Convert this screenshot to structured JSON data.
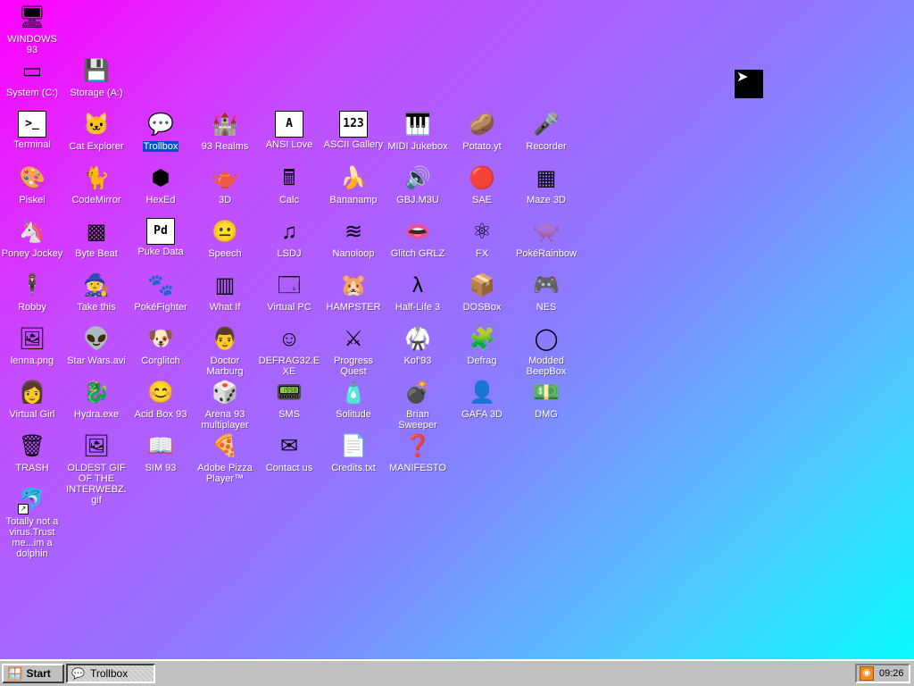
{
  "desktop": {
    "icons": [
      {
        "label": "WINDOWS 93",
        "glyph": "🖥"
      },
      {
        "label": "System (C:)",
        "glyph": "▭"
      },
      {
        "label": "Storage (A:)",
        "glyph": "💾"
      },
      {
        "label": "Terminal",
        "glyph": ">_"
      },
      {
        "label": "Cat Explorer",
        "glyph": "🐱"
      },
      {
        "label": "Trollbox",
        "glyph": "💬"
      },
      {
        "label": "93 Realms",
        "glyph": "🏰"
      },
      {
        "label": "ANSI Love",
        "glyph": "A"
      },
      {
        "label": "ASCII Gallery",
        "glyph": "123"
      },
      {
        "label": "MIDI Jukebox",
        "glyph": "🎹"
      },
      {
        "label": "Potato.yt",
        "glyph": "🥔"
      },
      {
        "label": "Recorder",
        "glyph": "🎤"
      },
      {
        "label": "Piskel",
        "glyph": "🎨"
      },
      {
        "label": "CodeMirror",
        "glyph": "🐈"
      },
      {
        "label": "HexEd",
        "glyph": "⬢"
      },
      {
        "label": "3D",
        "glyph": "🫖"
      },
      {
        "label": "Calc",
        "glyph": "🖩"
      },
      {
        "label": "Bananamp",
        "glyph": "🍌"
      },
      {
        "label": "GBJ.M3U",
        "glyph": "🔊"
      },
      {
        "label": "SAE",
        "glyph": "🔴"
      },
      {
        "label": "Maze 3D",
        "glyph": "▦"
      },
      {
        "label": "Poney Jockey",
        "glyph": "🦄"
      },
      {
        "label": "Byte Beat",
        "glyph": "▩"
      },
      {
        "label": "Puke Data",
        "glyph": "Pd"
      },
      {
        "label": "Speech",
        "glyph": "😐"
      },
      {
        "label": "LSDJ",
        "glyph": "♫"
      },
      {
        "label": "Nanoloop",
        "glyph": "≋"
      },
      {
        "label": "Glitch GRLZ",
        "glyph": "👄"
      },
      {
        "label": "FX",
        "glyph": "⚛"
      },
      {
        "label": "PokéRainbow",
        "glyph": "👾"
      },
      {
        "label": "Robby",
        "glyph": "🕴"
      },
      {
        "label": "Take this",
        "glyph": "🧙"
      },
      {
        "label": "PokéFighter",
        "glyph": "🐾"
      },
      {
        "label": "What If",
        "glyph": "▥"
      },
      {
        "label": "Virtual PC",
        "glyph": "🗔"
      },
      {
        "label": "HAMPSTER",
        "glyph": "🐹"
      },
      {
        "label": "Half-Life 3",
        "glyph": "λ"
      },
      {
        "label": "DOSBox",
        "glyph": "📦"
      },
      {
        "label": "NES",
        "glyph": "🎮"
      },
      {
        "label": "lenna.png",
        "glyph": "🖼"
      },
      {
        "label": "Star Wars.avi",
        "glyph": "👽"
      },
      {
        "label": "Corglitch",
        "glyph": "🐶"
      },
      {
        "label": "Doctor Marburg",
        "glyph": "👨"
      },
      {
        "label": "DEFRAG32.EXE",
        "glyph": "☺"
      },
      {
        "label": "Progress Quest",
        "glyph": "⚔"
      },
      {
        "label": "Kof'93",
        "glyph": "🥋"
      },
      {
        "label": "Defrag",
        "glyph": "🧩"
      },
      {
        "label": "Modded BeepBox",
        "glyph": "◯"
      },
      {
        "label": "Virtual Girl",
        "glyph": "👩"
      },
      {
        "label": "Hydra.exe",
        "glyph": "🐉"
      },
      {
        "label": "Acid Box 93",
        "glyph": "😊"
      },
      {
        "label": "Arena 93 multiplayer",
        "glyph": "🎲"
      },
      {
        "label": "SMS",
        "glyph": "📟"
      },
      {
        "label": "Solitude",
        "glyph": "🧴"
      },
      {
        "label": "Brian Sweeper",
        "glyph": "💣"
      },
      {
        "label": "GAFA 3D",
        "glyph": "👤"
      },
      {
        "label": "DMG",
        "glyph": "💵"
      },
      {
        "label": "TRASH",
        "glyph": "🗑"
      },
      {
        "label": "OLDEST GIF OF THE INTERWEBZ.gif",
        "glyph": "🖼"
      },
      {
        "label": "SIM 93",
        "glyph": "📖"
      },
      {
        "label": "Adobe Pizza Player™",
        "glyph": "🍕"
      },
      {
        "label": "Contact us",
        "glyph": "✉"
      },
      {
        "label": "Credits.txt",
        "glyph": "📄"
      },
      {
        "label": "MANIFESTO",
        "glyph": "❓"
      },
      {
        "label": "Totally not a virus.Trust me...im a dolphin",
        "glyph": "🐬"
      }
    ]
  },
  "taskbar": {
    "start_label": "Start",
    "tasks": [
      {
        "label": "Trollbox"
      }
    ],
    "clock": "09:26"
  },
  "colors": {
    "gradient_start": "#ff00ff",
    "gradient_end": "#00ffff",
    "taskbar": "#c0c0c0",
    "selection": "#0050d0"
  }
}
